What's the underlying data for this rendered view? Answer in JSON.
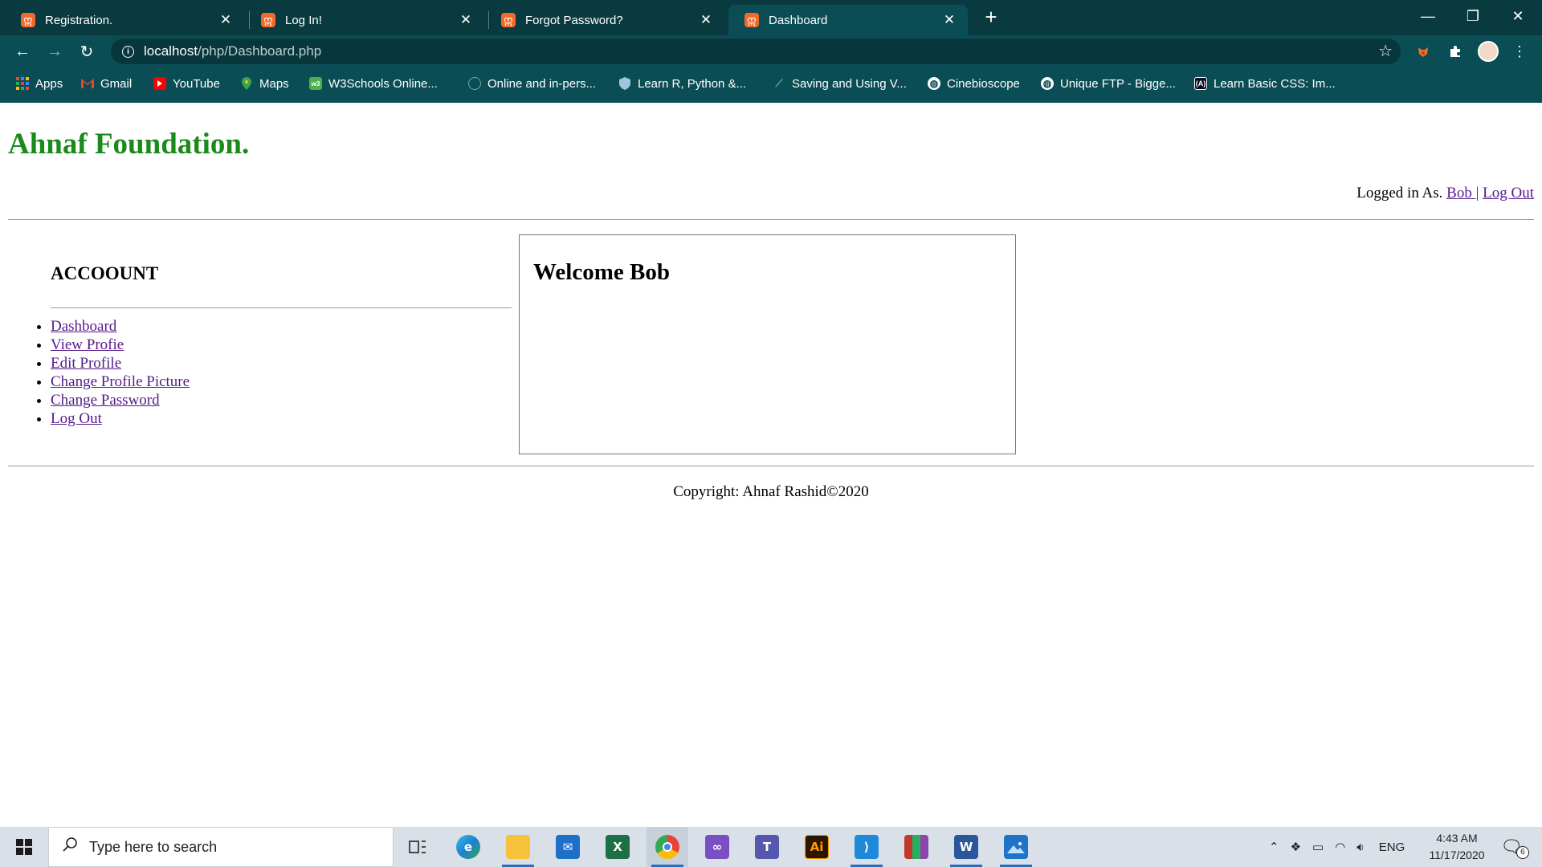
{
  "browser": {
    "tabs": [
      {
        "title": "Registration.",
        "active": false
      },
      {
        "title": "Log In!",
        "active": false
      },
      {
        "title": "Forgot Password?",
        "active": false
      },
      {
        "title": "Dashboard",
        "active": true
      }
    ],
    "url_host": "localhost",
    "url_path": "/php/Dashboard.php",
    "bookmarks": [
      {
        "label": "Apps",
        "icon": "apps-grid-icon"
      },
      {
        "label": "Gmail",
        "icon": "gmail-icon"
      },
      {
        "label": "YouTube",
        "icon": "youtube-icon"
      },
      {
        "label": "Maps",
        "icon": "maps-pin-icon"
      },
      {
        "label": "W3Schools Online...",
        "icon": "w3schools-icon"
      },
      {
        "label": "Online and in-pers...",
        "icon": "site-icon"
      },
      {
        "label": "Learn R, Python &...",
        "icon": "shield-icon"
      },
      {
        "label": "Saving and Using V...",
        "icon": "site-icon"
      },
      {
        "label": "Cinebioscope",
        "icon": "globe-icon"
      },
      {
        "label": "Unique FTP - Bigge...",
        "icon": "globe-icon"
      },
      {
        "label": "Learn Basic CSS: Im...",
        "icon": "freecodecamp-icon"
      }
    ]
  },
  "page": {
    "site_title": "Ahnaf Foundation.",
    "logged_in_prefix": "Logged in As.",
    "username_link": "Bob ",
    "separator": "|",
    "logout_link": "Log Out",
    "sidebar_title": "ACCOOUNT",
    "sidebar_items": [
      "Dashboard",
      "View Profie",
      "Edit Profile",
      "Change Profile Picture",
      "Change Password",
      "Log Out"
    ],
    "welcome_heading": "Welcome Bob",
    "footer": "Copyright: Ahnaf Rashid©2020"
  },
  "taskbar": {
    "search_placeholder": "Type here to search",
    "language": "ENG",
    "time": "4:43 AM",
    "date": "11/17/2020",
    "notification_count": "6"
  },
  "colors": {
    "chrome_frame": "#083a40",
    "chrome_toolbar": "#0b4d55",
    "site_title": "#1a8a1a",
    "visited_link": "#551a8b",
    "taskbar": "#d9e0e8"
  }
}
